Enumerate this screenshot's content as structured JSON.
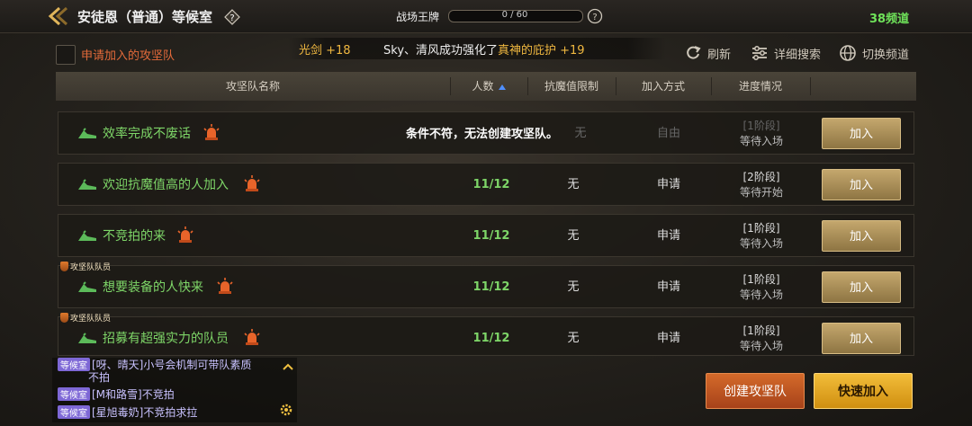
{
  "header": {
    "title": "安徒恩（普通）等候室",
    "battle_pass_label": "战场王牌",
    "battle_pass_progress": "0 / 60",
    "battle_pass_fraction": 0,
    "channel": "38频道"
  },
  "toolbar": {
    "apply_label": "申请加入的攻坚队",
    "refresh": "刷新",
    "detail_search": "详细搜索",
    "switch_channel": "切换频道"
  },
  "ticker": {
    "left_text": "光剑 +18",
    "right_prefix": "Sky、清风成功强化了",
    "right_item": "真神的庇护 +19"
  },
  "table": {
    "columns": [
      "攻坚队名称",
      "人数",
      "抗魔值限制",
      "加入方式",
      "进度情况"
    ],
    "rows": [
      {
        "name": "效率完成不废话",
        "count": "",
        "limit": "无",
        "mode": "自由",
        "stage": "[1阶段]",
        "status": "等待入场",
        "join": "加入",
        "tag": "",
        "message": "条件不符，无法创建攻坚队。"
      },
      {
        "name": "欢迎抗魔值高的人加入",
        "count": "11/12",
        "limit": "无",
        "mode": "申请",
        "stage": "[2阶段]",
        "status": "等待开始",
        "join": "加入",
        "tag": ""
      },
      {
        "name": "不竞拍的来",
        "count": "11/12",
        "limit": "无",
        "mode": "申请",
        "stage": "[1阶段]",
        "status": "等待入场",
        "join": "加入",
        "tag": ""
      },
      {
        "name": "想要装备的人快来",
        "count": "11/12",
        "limit": "无",
        "mode": "申请",
        "stage": "[1阶段]",
        "status": "等待入场",
        "join": "加入",
        "tag": "攻坚队队员"
      },
      {
        "name": "招募有超强实力的队员",
        "count": "11/12",
        "limit": "无",
        "mode": "申请",
        "stage": "[1阶段]",
        "status": "等待入场",
        "join": "加入",
        "tag": "攻坚队队员"
      }
    ]
  },
  "chat": {
    "lines": [
      {
        "tag": "等候室",
        "text": "[呀、晴天]小号会机制可带队素质"
      },
      {
        "tag": "",
        "text": "不拍"
      },
      {
        "tag": "等候室",
        "text": "[M和路雪]不竞拍"
      },
      {
        "tag": "等候室",
        "text": "[星旭毒奶]不竞拍求拉"
      }
    ]
  },
  "actions": {
    "create": "创建攻坚队",
    "quick_join": "快速加入"
  },
  "colors": {
    "green": "#7ed668",
    "gold": "#f0b840",
    "orange_button": "#d46a2a",
    "yellow_button": "#f2bd3a"
  }
}
